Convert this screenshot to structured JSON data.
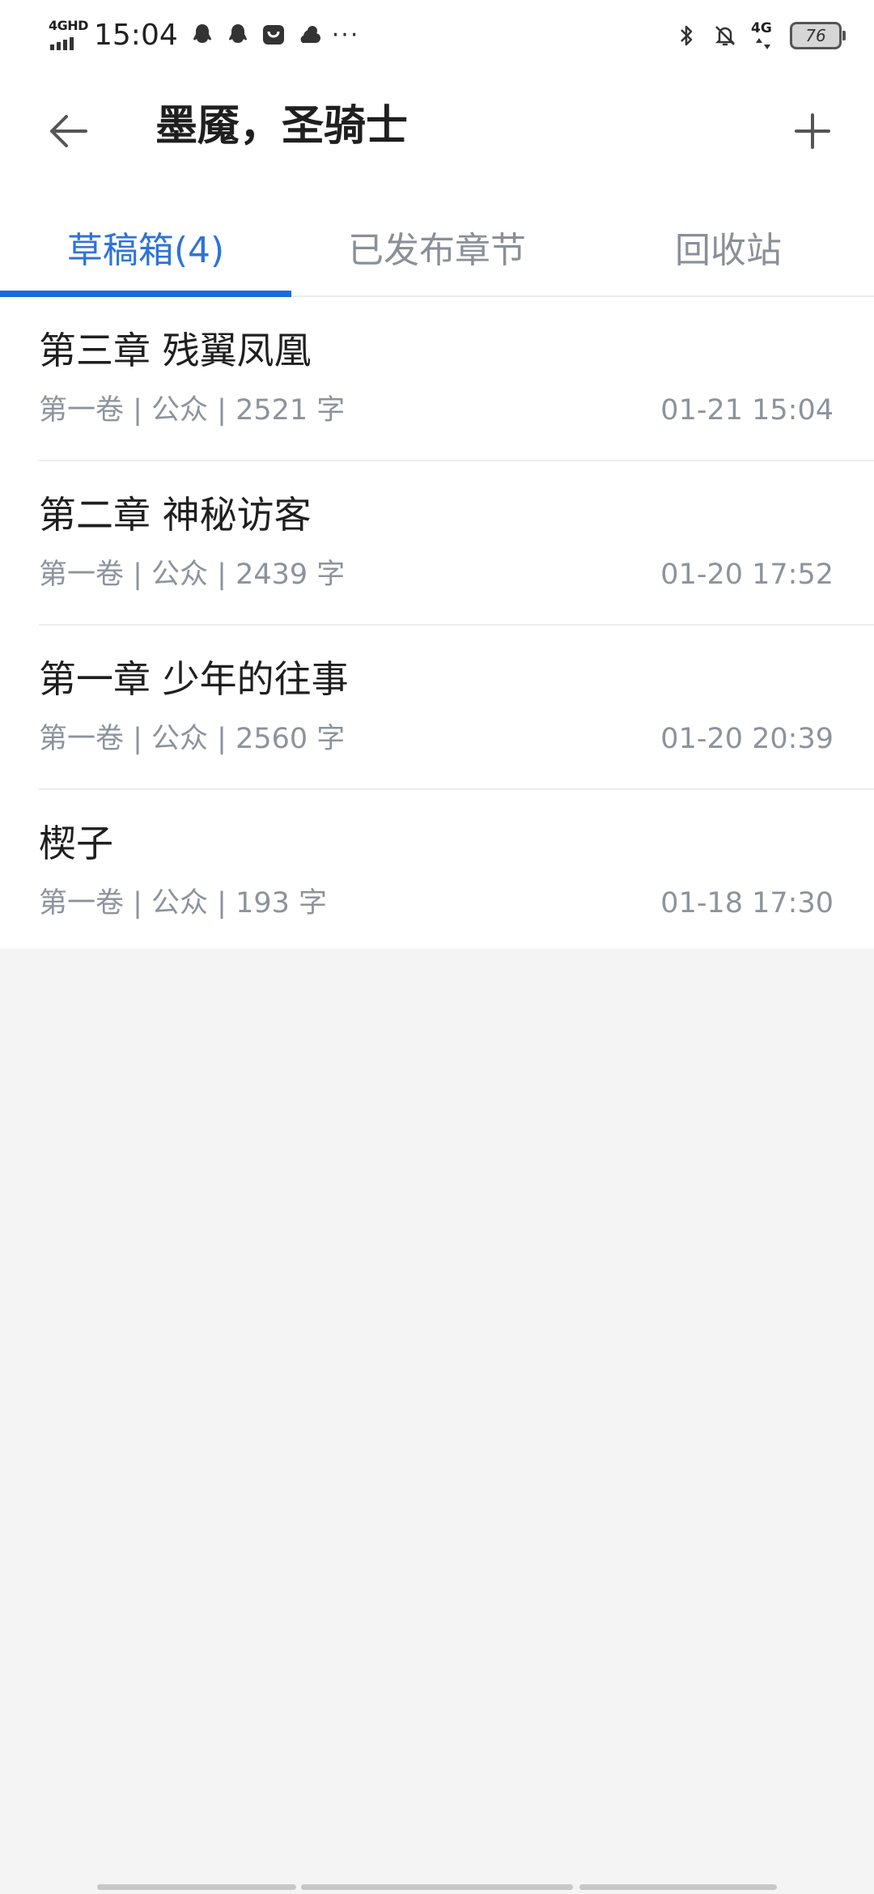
{
  "status_bar": {
    "network": "4GHD",
    "time": "15:04",
    "network_right": "4G",
    "battery": "76",
    "more": "···"
  },
  "header": {
    "title": "墨魇，圣骑士"
  },
  "tabs": [
    {
      "label": "草稿箱(4)",
      "active": true
    },
    {
      "label": "已发布章节",
      "active": false
    },
    {
      "label": "回收站",
      "active": false
    }
  ],
  "drafts": [
    {
      "title": "第三章 残翼凤凰",
      "meta": "第一卷 | 公众 | 2521 字",
      "time": "01-21 15:04"
    },
    {
      "title": "第二章 神秘访客",
      "meta": "第一卷 | 公众 | 2439 字",
      "time": "01-20 17:52"
    },
    {
      "title": "第一章 少年的往事",
      "meta": "第一卷 | 公众 | 2560 字",
      "time": "01-20 20:39"
    },
    {
      "title": "楔子",
      "meta": "第一卷 | 公众 | 193 字",
      "time": "01-18 17:30"
    }
  ],
  "colors": {
    "accent": "#2f73d8",
    "indicator": "#1a6be0",
    "muted": "#8d939d",
    "background": "#f4f4f4"
  }
}
